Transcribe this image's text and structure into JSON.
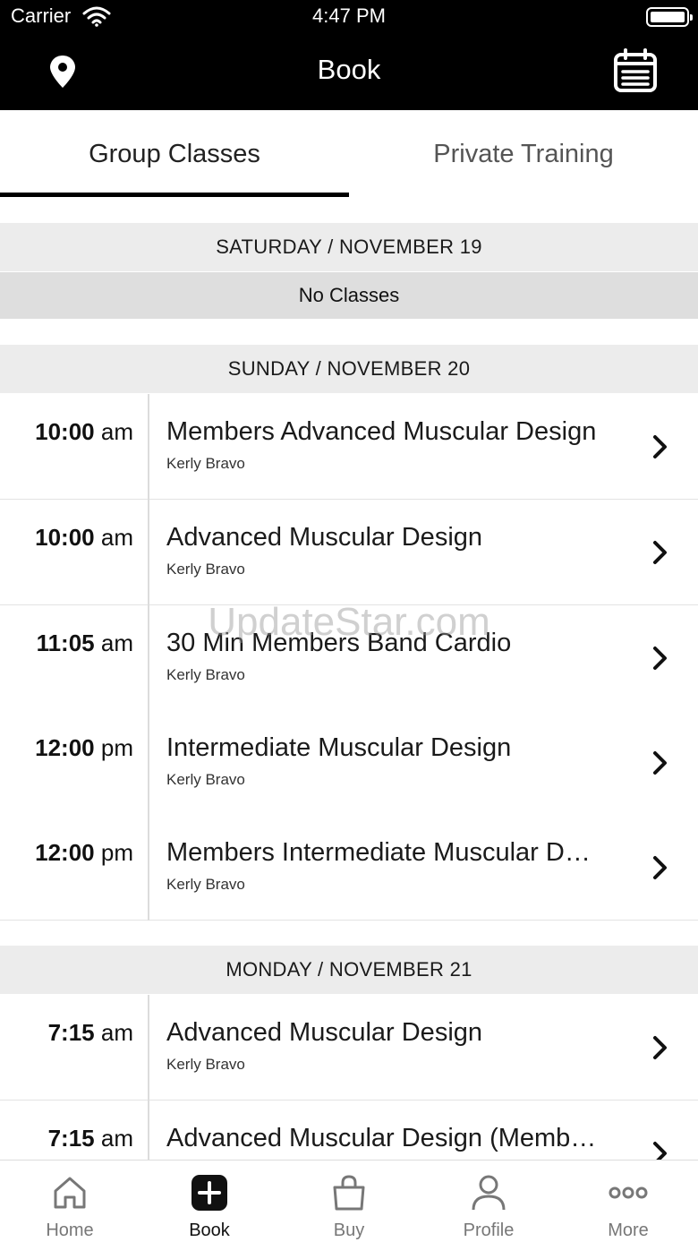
{
  "status_bar": {
    "carrier": "Carrier",
    "time": "4:47 PM"
  },
  "header": {
    "title": "Book"
  },
  "tabs": [
    {
      "label": "Group Classes",
      "active": true
    },
    {
      "label": "Private Training",
      "active": false
    }
  ],
  "days": [
    {
      "header": "SATURDAY / NOVEMBER 19",
      "empty_text": "No Classes",
      "classes": []
    },
    {
      "header": "SUNDAY / NOVEMBER 20",
      "classes": [
        {
          "time": "10:00",
          "period": "am",
          "name": "Members Advanced Muscular Design",
          "instructor": "Kerly Bravo"
        },
        {
          "time": "10:00",
          "period": "am",
          "name": "Advanced Muscular Design",
          "instructor": "Kerly Bravo"
        },
        {
          "time": "11:05",
          "period": "am",
          "name": "30 Min Members Band Cardio",
          "instructor": "Kerly Bravo"
        },
        {
          "time": "12:00",
          "period": "pm",
          "name": "Intermediate Muscular Design",
          "instructor": "Kerly Bravo"
        },
        {
          "time": "12:00",
          "period": "pm",
          "name": "Members Intermediate Muscular D…",
          "instructor": "Kerly Bravo"
        }
      ]
    },
    {
      "header": "MONDAY / NOVEMBER 21",
      "classes": [
        {
          "time": "7:15",
          "period": "am",
          "name": "Advanced Muscular Design",
          "instructor": "Kerly Bravo"
        },
        {
          "time": "7:15",
          "period": "am",
          "name": "Advanced Muscular Design (Memb…",
          "instructor": ""
        }
      ]
    }
  ],
  "watermark": "UpdateStar.com",
  "tab_bar": [
    {
      "label": "Home",
      "icon": "home-icon",
      "active": false
    },
    {
      "label": "Book",
      "icon": "plus-square-icon",
      "active": true
    },
    {
      "label": "Buy",
      "icon": "shopping-bag-icon",
      "active": false
    },
    {
      "label": "Profile",
      "icon": "person-icon",
      "active": false
    },
    {
      "label": "More",
      "icon": "more-dots-icon",
      "active": false
    }
  ]
}
